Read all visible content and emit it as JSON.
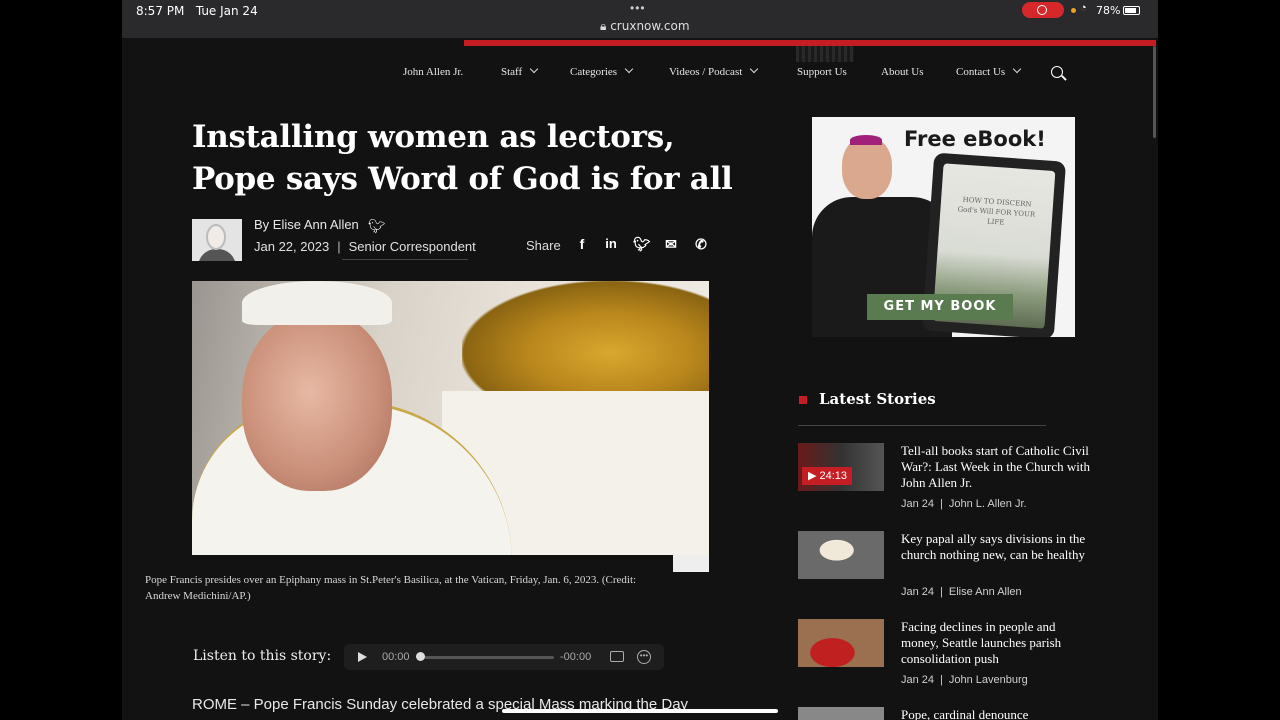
{
  "statusbar": {
    "time": "8:57 PM",
    "date": "Tue Jan 24",
    "url": "cruxnow.com",
    "battery": "78%"
  },
  "nav": {
    "items": [
      {
        "label": "John Allen Jr."
      },
      {
        "label": "Staff"
      },
      {
        "label": "Categories"
      },
      {
        "label": "Videos / Podcast"
      },
      {
        "label": "Support Us"
      },
      {
        "label": "About Us"
      },
      {
        "label": "Contact Us"
      }
    ]
  },
  "article": {
    "headline": "Installing women as lectors, Pope says Word of God is for all",
    "byline": "By Elise Ann Allen",
    "date": "Jan 22, 2023",
    "role": "Senior Correspondent",
    "share_label": "Share",
    "caption": "Pope Francis presides over an Epiphany mass in St.Peter's Basilica, at the Vatican, Friday, Jan. 6, 2023. (Credit: Andrew Medichini/AP.)",
    "listen_label": "Listen to this story:",
    "time_elapsed": "00:00",
    "time_remaining": "-00:00",
    "body_start": "ROME – Pope Francis Sunday celebrated a special Mass marking the Day"
  },
  "ad": {
    "title": "Free eBook!",
    "book_text": "HOW TO DISCERN God's Will FOR YOUR LIFE",
    "button": "GET MY BOOK"
  },
  "latest": {
    "heading": "Latest Stories",
    "stories": [
      {
        "title": "Tell-all books start of Catholic Civil War?: Last Week in the Church with John Allen Jr.",
        "date": "Jan 24",
        "author": "John L. Allen Jr.",
        "badge": "24:13"
      },
      {
        "title": "Key papal ally says divisions in the church nothing new, can be healthy",
        "date": "Jan 24",
        "author": "Elise Ann Allen"
      },
      {
        "title": "Facing declines in people and money, Seattle launches parish consolidation push",
        "date": "Jan 24",
        "author": "John Lavenburg"
      },
      {
        "title": "Pope, cardinal denounce"
      }
    ]
  },
  "colors": {
    "accent": "#c41e24",
    "background": "#121212",
    "ad_button": "#5a7a50"
  }
}
